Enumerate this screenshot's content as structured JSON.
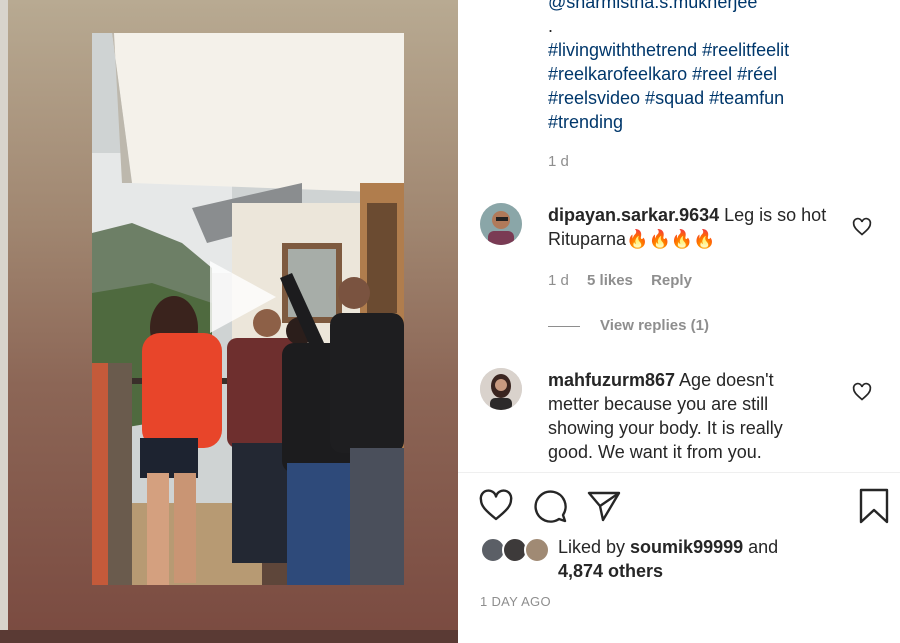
{
  "caption": {
    "mention": "@sharmistha.s.mukherjee",
    "dot": ".",
    "tags_line1": "#livingwiththetrend #reelitfeelit",
    "tags_line2": "#reelkarofeelkaro #reel #réel",
    "tags_line3": "#reelsvideo #squad #teamfun",
    "tags_line4": "#trending",
    "time": "1 d"
  },
  "comments": [
    {
      "username": "dipayan.sarkar.9634",
      "text_line1": " Leg is so hot",
      "text_line2": "Rituparna🔥🔥🔥🔥",
      "time": "1 d",
      "likes": "5 likes",
      "reply": "Reply"
    },
    {
      "username": "mahfuzurm867",
      "text_line1": " Age doesn't",
      "text_line2": "metter because you are still",
      "text_line3": "showing your body. It is really",
      "text_line4": "good. We want it from you."
    }
  ],
  "view_replies": "View replies (1)",
  "likes": {
    "prefix": "Liked by ",
    "user": "soumik99999",
    "and": " and",
    "others": "4,874 others"
  },
  "post_date": "1 DAY AGO",
  "icons": {
    "like": "heart-icon",
    "comment": "comment-icon",
    "share": "send-icon",
    "save": "bookmark-icon",
    "play": "play-icon"
  },
  "colors": {
    "link": "#00376b",
    "muted": "#8e8e8e",
    "text": "#262626"
  }
}
